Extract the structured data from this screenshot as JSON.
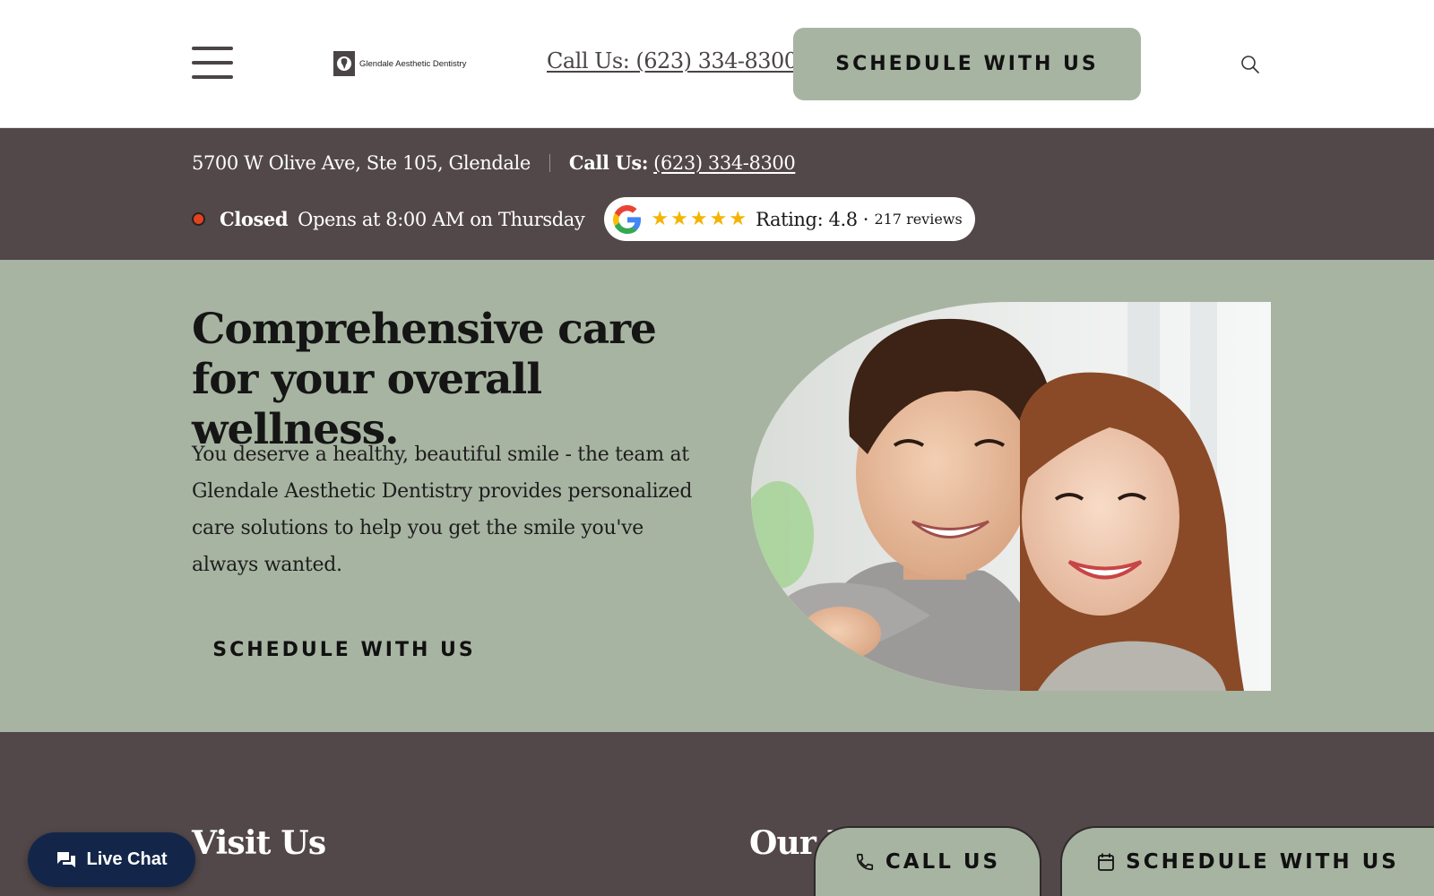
{
  "header": {
    "logo_text": "Glendale Aesthetic Dentistry",
    "call_label": "Call Us: (623) 334-8300",
    "schedule_label": "SCHEDULE WITH US"
  },
  "info_bar": {
    "address": "5700 W Olive Ave, Ste 105, Glendale",
    "call_label": "Call Us:",
    "call_number": "(623) 334-8300",
    "status": "Closed",
    "hours": "Opens at 8:00 AM on Thursday",
    "rating": {
      "stars": 5,
      "text": "Rating: 4.8",
      "separator": "·",
      "reviews": "217 reviews"
    }
  },
  "hero": {
    "title": "Comprehensive care for your overall wellness.",
    "body": "You deserve a healthy, beautiful smile - the team at Glendale Aesthetic Dentistry provides personalized care solutions to help you get the smile you've always wanted.",
    "cta_label": "SCHEDULE WITH US"
  },
  "bottom": {
    "visit_heading": "Visit Us",
    "our_heading": "Our L"
  },
  "floating": {
    "live_chat_label": "Live Chat",
    "call_label": "CALL US",
    "schedule_label": "SCHEDULE WITH US"
  },
  "colors": {
    "sage": "#a8b4a2",
    "dark_brown": "#524749",
    "chat_navy": "#13264a",
    "status_red": "#e0431f",
    "star_gold": "#f4b400"
  },
  "icons": [
    "hamburger-menu-icon",
    "logo-icon",
    "search-icon",
    "google-icon",
    "star-icon",
    "chat-bubble-icon",
    "phone-icon",
    "calendar-icon"
  ]
}
